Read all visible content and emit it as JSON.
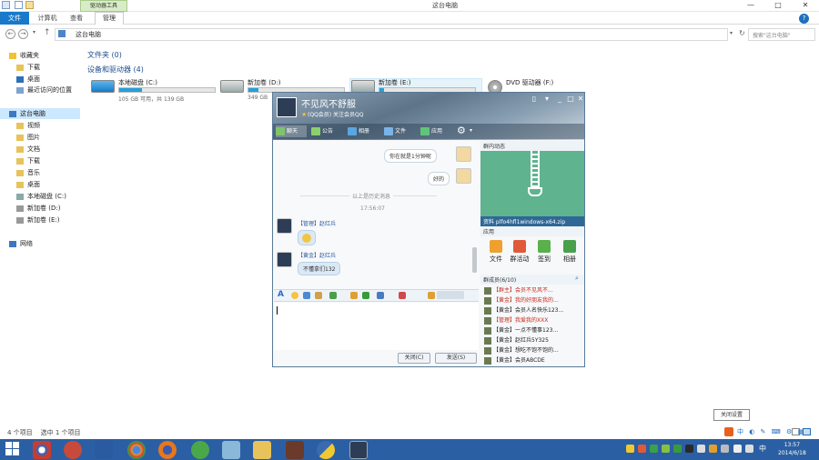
{
  "explorer": {
    "title": "这台电脑",
    "context_tab": "驱动器工具",
    "tabs": {
      "file": "文件",
      "computer": "计算机",
      "view": "查看",
      "manage": "管理"
    },
    "address": "这台电脑",
    "search_placeholder": "搜索\"这台电脑\"",
    "sections": {
      "folders": "文件夹 (0)",
      "devices": "设备和驱动器 (4)"
    },
    "drives": [
      {
        "name": "本地磁盘 (C:)",
        "free": "105 GB 可用，共 139 GB",
        "used_fraction": 0.24
      },
      {
        "name": "新加卷 (D:)",
        "free": "349 GB",
        "used_fraction": 0.1
      },
      {
        "name": "新加卷 (E:)",
        "free": "",
        "used_fraction": 0.05
      },
      {
        "name": "DVD 驱动器 (F:)",
        "free": "",
        "used_fraction": 0
      }
    ],
    "nav_favorites": [
      "收藏夹",
      "下载",
      "桌面",
      "最近访问的位置"
    ],
    "nav_pc": [
      "这台电脑",
      "视频",
      "图片",
      "文档",
      "下载",
      "音乐",
      "桌面",
      "本地磁盘 (C:)",
      "新加卷 (D:)",
      "新加卷 (E:)"
    ],
    "nav_network": "网络",
    "status": {
      "count": "4 个项目",
      "selected": "选中 1 个项目"
    }
  },
  "qq": {
    "name": "不见风不舒服",
    "signature": "(QQ会员) 关注会员QQ",
    "toolbar": [
      "聊天",
      "公告",
      "相册",
      "文件",
      "应用"
    ],
    "messages": [
      {
        "side": "right",
        "text": "你在就是1分钟呢"
      },
      {
        "side": "right",
        "text": "好的"
      }
    ],
    "divider": "以上是历史消息",
    "time": "17:56:07",
    "incoming": [
      {
        "sender": "【管理】赵红兵",
        "text": ""
      },
      {
        "sender": "【黄金】赵红兵",
        "text": "不懂拿们132"
      }
    ],
    "btn_close": "关闭(C)",
    "btn_send": "发送(S)",
    "rp_title": "群内动态",
    "rp_info": "资料 plfo4hfl1windows-x64.zip",
    "rp_apps_title": "应用",
    "apps": [
      "文件",
      "群活动",
      "签到",
      "相册"
    ],
    "members_title": "群成员(6/10)",
    "members": [
      {
        "text": "【群主】会员不见风不...",
        "color": "#c62a1e"
      },
      {
        "text": "【黄金】我的好朋友我的...",
        "color": "#c62a1e"
      },
      {
        "text": "【黄金】会员人名快乐123...",
        "color": "#222"
      },
      {
        "text": "【管理】我爱我的XXX",
        "color": "#c62a1e"
      },
      {
        "text": "【黄金】一点不懂事123...",
        "color": "#222"
      },
      {
        "text": "【黄金】赵红兵5Y325",
        "color": "#222"
      },
      {
        "text": "【黄金】想吃不饱不饱的...",
        "color": "#222"
      },
      {
        "text": "【黄金】会员ABCDE",
        "color": "#222"
      }
    ]
  },
  "tooltip": "关闭设置",
  "clock": {
    "time": "13:57",
    "date": "2014/6/18"
  }
}
